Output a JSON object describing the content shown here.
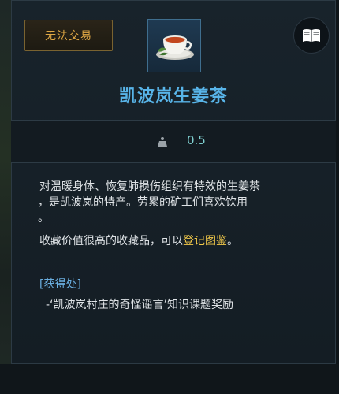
{
  "item": {
    "trade_badge": "无法交易",
    "name": "凯波岚生姜茶",
    "icon": "ginger-tea-cup-icon",
    "weight": "0.5",
    "description": {
      "line1": "对温暖身体、恢复肺损伤组织有特效的生姜茶",
      "line2": "，是凯波岚的特产。劳累的矿工们喜欢饮用",
      "line2_end": "。",
      "line3_prefix": "收藏价值很高的收藏品，可以",
      "line3_link": "登记图鉴",
      "line3_suffix": "。"
    },
    "source": {
      "header": "[获得处]",
      "entries": [
        "-‘凯波岚村庄的奇怪谣言’知识课题奖励"
      ]
    }
  },
  "controls": {
    "book_icon": "book-icon"
  },
  "colors": {
    "title": "#58b4e8",
    "badge_text": "#e0a845",
    "highlight": "#f2c94a",
    "source_header": "#6aaee0",
    "weight_value": "#7fd0d0"
  }
}
